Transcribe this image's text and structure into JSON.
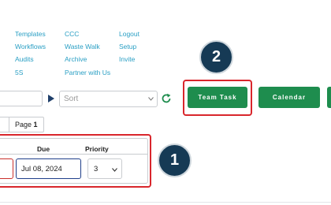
{
  "nav": {
    "col1": [
      "Templates",
      "Workflows",
      "Audits",
      "5S"
    ],
    "col2": [
      "CCC",
      "Waste Walk",
      "Archive",
      "Partner with Us"
    ],
    "col3": [
      "Logout",
      "Setup",
      "Invite"
    ]
  },
  "toolbar": {
    "sort_placeholder": "Sort",
    "team_task_label": "Team Task",
    "calendar_label": "Calendar"
  },
  "pagination": {
    "prefix": "Page",
    "current": "1"
  },
  "table": {
    "headers": {
      "due": "Due",
      "priority": "Priority"
    },
    "row": {
      "due": "Jul 08, 2024",
      "priority": "3"
    }
  },
  "markers": {
    "table_marker": "1",
    "button_marker": "2"
  },
  "colors": {
    "link": "#2a9fc4",
    "button_green": "#1e8d4e",
    "highlight_red": "#d9262c",
    "marker_navy": "#163a55"
  },
  "icons": {
    "play": "play-icon",
    "select_chevron": "chevron-down-icon",
    "refresh": "refresh-icon"
  }
}
